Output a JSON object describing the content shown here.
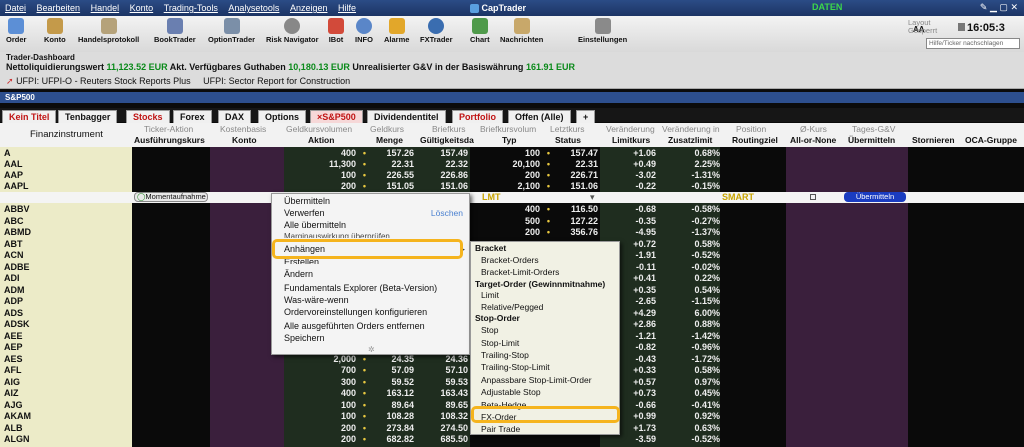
{
  "menubar": {
    "items": [
      "Datei",
      "Bearbeiten",
      "Handel",
      "Konto",
      "Trading-Tools",
      "Analysetools",
      "Anzeigen",
      "Hilfe"
    ],
    "app_title": "CapTrader",
    "status": "DATEN"
  },
  "toolbar": {
    "buttons": [
      {
        "label": "Order",
        "icon": "order-icon"
      },
      {
        "label": "Konto",
        "icon": "account-icon"
      },
      {
        "label": "Handelsprotokoll",
        "icon": "trade-log-icon"
      },
      {
        "label": "BookTrader",
        "icon": "booktrader-icon"
      },
      {
        "label": "OptionTrader",
        "icon": "optiontrader-icon"
      },
      {
        "label": "Risk Navigator",
        "icon": "risk-navigator-icon"
      },
      {
        "label": "IBot",
        "icon": "ibot-icon"
      },
      {
        "label": "INFO",
        "icon": "info-icon"
      },
      {
        "label": "Alarme",
        "icon": "alarm-icon"
      },
      {
        "label": "FXTrader",
        "icon": "fxtrader-icon"
      },
      {
        "label": "Chart",
        "icon": "chart-icon"
      },
      {
        "label": "Nachrichten",
        "icon": "news-icon"
      },
      {
        "label": "Einstellungen",
        "icon": "settings-icon"
      }
    ],
    "aa_label": "AA",
    "layout_label": "Layout\nGesperrt",
    "clock": "16:05:3",
    "search_placeholder": "Hilfe/Ticker nachschlagen"
  },
  "dashboard": {
    "title": "Trader-Dashboard",
    "net_liq_label": "Nettoliquidierungswert",
    "net_liq_value": "11,123.52 EUR",
    "avail_label": "Akt. Verfügbares Guthaben",
    "avail_value": "10,180.13 EUR",
    "unrealized_label": "Unrealisierter G&V in der Basiswährung",
    "unrealized_value": "161.91 EUR",
    "news": [
      "UFPI: UFPI-O - Reuters Stock Reports Plus",
      "UFPI: Sector Report for Construction"
    ]
  },
  "window_title": "S&P500",
  "tabs": [
    {
      "label": "Kein Titel",
      "style": "red"
    },
    {
      "label": "Tenbagger",
      "style": "normal"
    },
    {
      "label": "Stocks",
      "style": "red"
    },
    {
      "label": "Forex",
      "style": "normal"
    },
    {
      "label": "DAX",
      "style": "normal"
    },
    {
      "label": "Options",
      "style": "normal"
    },
    {
      "label": "×S&P500",
      "style": "active"
    },
    {
      "label": "Dividendentitel",
      "style": "normal"
    },
    {
      "label": "Portfolio",
      "style": "red"
    },
    {
      "label": "Offen (Alle)",
      "style": "normal"
    },
    {
      "label": "+",
      "style": "normal"
    }
  ],
  "columns": {
    "top": [
      "Finanzinstrument",
      "Ticker-Aktion",
      "Kostenbasis",
      "Geldkursvolumen",
      "Geldkurs",
      "Briefkurs",
      "Briefkursvolum",
      "Letztkurs",
      "Veränderung",
      "Veränderung in",
      "Position",
      "Ø-Kurs",
      "Tages-G&V"
    ],
    "bottom": [
      "Ausführungskurs",
      "Konto",
      "Aktion",
      "Menge",
      "Gültigkeitsda",
      "Typ",
      "Status",
      "Limitkurs",
      "Zusatzlimit",
      "Routingziel",
      "All-or-None",
      "Übermitteln",
      "Stornieren",
      "OCA-Gruppe"
    ]
  },
  "rows": [
    {
      "sym": "A",
      "bidsize": "400",
      "bid": "157.26",
      "ask": "157.49",
      "asksize": "100",
      "last": "157.47",
      "chg": "+1.06",
      "pct": "0.68%"
    },
    {
      "sym": "AAL",
      "bidsize": "11,300",
      "bid": "22.31",
      "ask": "22.32",
      "asksize": "20,100",
      "last": "22.31",
      "chg": "+0.49",
      "pct": "2.25%"
    },
    {
      "sym": "AAP",
      "bidsize": "100",
      "bid": "226.55",
      "ask": "226.86",
      "asksize": "200",
      "last": "226.71",
      "chg": "-3.02",
      "pct": "-1.31%"
    },
    {
      "sym": "AAPL",
      "bidsize": "200",
      "bid": "151.05",
      "ask": "151.06",
      "asksize": "2,100",
      "last": "151.06",
      "chg": "-0.22",
      "pct": "-0.15%"
    },
    {
      "sym": "ABBV",
      "bidsize": "",
      "bid": "",
      "ask": "",
      "asksize": "400",
      "last": "116.50",
      "chg": "-0.68",
      "pct": "-0.58%"
    },
    {
      "sym": "ABC",
      "bidsize": "",
      "bid": "",
      "ask": "",
      "asksize": "500",
      "last": "127.22",
      "chg": "-0.35",
      "pct": "-0.27%"
    },
    {
      "sym": "ABMD",
      "bidsize": "",
      "bid": "",
      "ask": "",
      "asksize": "200",
      "last": "356.76",
      "chg": "-4.95",
      "pct": "-1.37%"
    },
    {
      "sym": "ABT",
      "bidsize": "",
      "bid": "",
      "ask": "",
      "asksize": "",
      "last": "",
      "chg": "+0.72",
      "pct": "0.58%"
    },
    {
      "sym": "ACN",
      "bidsize": "",
      "bid": "",
      "ask": "",
      "asksize": "",
      "last": "",
      "chg": "-1.91",
      "pct": "-0.52%"
    },
    {
      "sym": "ADBE",
      "bidsize": "",
      "bid": "",
      "ask": "",
      "asksize": "",
      "last": "",
      "chg": "-0.11",
      "pct": "-0.02%"
    },
    {
      "sym": "ADI",
      "bidsize": "",
      "bid": "",
      "ask": "",
      "asksize": "",
      "last": "",
      "chg": "+0.41",
      "pct": "0.22%"
    },
    {
      "sym": "ADM",
      "bidsize": "",
      "bid": "",
      "ask": "",
      "asksize": "",
      "last": "",
      "chg": "+0.35",
      "pct": "0.54%"
    },
    {
      "sym": "ADP",
      "bidsize": "",
      "bid": "",
      "ask": "",
      "asksize": "",
      "last": "",
      "chg": "-2.65",
      "pct": "-1.15%"
    },
    {
      "sym": "ADS",
      "bidsize": "",
      "bid": "",
      "ask": "",
      "asksize": "",
      "last": "",
      "chg": "+4.29",
      "pct": "6.00%"
    },
    {
      "sym": "ADSK",
      "bidsize": "",
      "bid": "",
      "ask": "",
      "asksize": "",
      "last": "",
      "chg": "+2.86",
      "pct": "0.88%"
    },
    {
      "sym": "AEE",
      "bidsize": "",
      "bid": "",
      "ask": "",
      "asksize": "",
      "last": "",
      "chg": "-1.21",
      "pct": "-1.42%"
    },
    {
      "sym": "AEP",
      "bidsize": "",
      "bid": "",
      "ask": "",
      "asksize": "",
      "last": "",
      "chg": "-0.82",
      "pct": "-0.96%"
    },
    {
      "sym": "AES",
      "bidsize": "2,000",
      "bid": "24.35",
      "ask": "24.36",
      "asksize": "",
      "last": "",
      "chg": "-0.43",
      "pct": "-1.72%"
    },
    {
      "sym": "AFL",
      "bidsize": "700",
      "bid": "57.09",
      "ask": "57.10",
      "asksize": "",
      "last": "",
      "chg": "+0.33",
      "pct": "0.58%"
    },
    {
      "sym": "AIG",
      "bidsize": "300",
      "bid": "59.52",
      "ask": "59.53",
      "asksize": "",
      "last": "",
      "chg": "+0.57",
      "pct": "0.97%"
    },
    {
      "sym": "AIZ",
      "bidsize": "400",
      "bid": "163.12",
      "ask": "163.43",
      "asksize": "",
      "last": "",
      "chg": "+0.73",
      "pct": "0.45%"
    },
    {
      "sym": "AJG",
      "bidsize": "100",
      "bid": "89.64",
      "ask": "89.65",
      "asksize": "",
      "last": "",
      "chg": "-0.66",
      "pct": "-0.41%"
    },
    {
      "sym": "AKAM",
      "bidsize": "100",
      "bid": "108.28",
      "ask": "108.32",
      "asksize": "",
      "last": "",
      "chg": "+0.99",
      "pct": "0.92%"
    },
    {
      "sym": "ALB",
      "bidsize": "200",
      "bid": "273.84",
      "ask": "274.50",
      "asksize": "",
      "last": "",
      "chg": "+1.73",
      "pct": "0.63%"
    },
    {
      "sym": "ALGN",
      "bidsize": "200",
      "bid": "682.82",
      "ask": "685.50",
      "asksize": "",
      "last": "",
      "chg": "-3.59",
      "pct": "-0.52%"
    }
  ],
  "order_entry": {
    "button": "Momentaufnahme",
    "type": "LMT",
    "route": "SMART",
    "submit": "Übermitteln"
  },
  "context_menu": {
    "items": [
      "Übermitteln",
      "Verwerfen",
      "Alle übermitteln",
      "Marginauswirkung überprüfen",
      "Anhängen",
      "Erstellen",
      "Ändern",
      "Fundamentals Explorer (Beta-Version)",
      "Was-wäre-wenn",
      "Ordervoreinstellungen konfigurieren",
      "Alle ausgeführten Orders entfernen",
      "Speichern"
    ],
    "delete_label": "Löschen"
  },
  "submenu": {
    "bracket_header": "Bracket",
    "bracket_items": [
      "Bracket-Orders",
      "Bracket-Limit-Orders"
    ],
    "target_header": "Target-Order (Gewinnmitnahme)",
    "target_items": [
      "Limit",
      "Relative/Pegged"
    ],
    "stop_header": "Stop-Order",
    "stop_items": [
      "Stop",
      "Stop-Limit",
      "Trailing-Stop",
      "Trailing-Stop-Limit",
      "Anpassbare Stop-Limit-Order",
      "Adjustable Stop"
    ],
    "other_items": [
      "Beta-Hedge",
      "FX-Order",
      "Pair Trade"
    ]
  }
}
